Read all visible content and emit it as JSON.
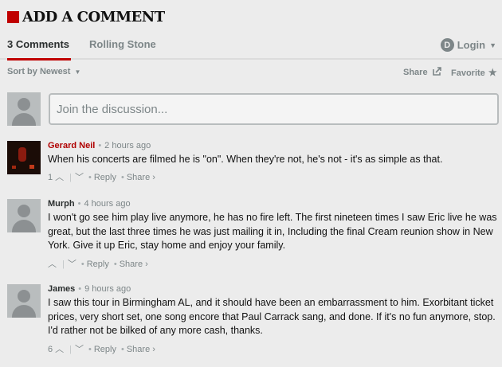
{
  "header": {
    "title": "ADD A COMMENT"
  },
  "tabs": [
    {
      "label": "3 Comments"
    },
    {
      "label": "Rolling Stone"
    }
  ],
  "login": {
    "icon_letter": "D",
    "label": "Login",
    "icon": "chevron-down-icon"
  },
  "sortbar": {
    "sort_label": "Sort by Newest",
    "share_label": "Share",
    "favorite_label": "Favorite"
  },
  "composer": {
    "placeholder": "Join the discussion..."
  },
  "comments": [
    {
      "author": "Gerard Neil",
      "time": "2 hours ago",
      "text": "When his concerts are filmed he is \"on\". When they're not, he's not - it's as simple as that.",
      "votes": "1",
      "reply": "Reply",
      "share": "Share ›",
      "author_color": "#b00000"
    },
    {
      "author": "Murph",
      "time": "4 hours ago",
      "text": "I won't go see him play live anymore, he has no fire left. The first nineteen times I saw Eric live he was great, but the last three times he was just mailing it in, Including the final Cream reunion show in New York. Give it up Eric, stay home and enjoy your family.",
      "votes": "",
      "reply": "Reply",
      "share": "Share ›"
    },
    {
      "author": "James",
      "time": "9 hours ago",
      "text": "I saw this tour in Birmingham AL, and it should have been an embarrassment to him. Exorbitant ticket prices, very short set, one song encore that Paul Carrack sang, and done. If it's no fun anymore, stop. I'd rather not be bilked of any more cash, thanks.",
      "votes": "6",
      "reply": "Reply",
      "share": "Share ›"
    }
  ],
  "colors": {
    "accent": "#c00000",
    "background": "#ececec",
    "muted": "#7d8688"
  }
}
